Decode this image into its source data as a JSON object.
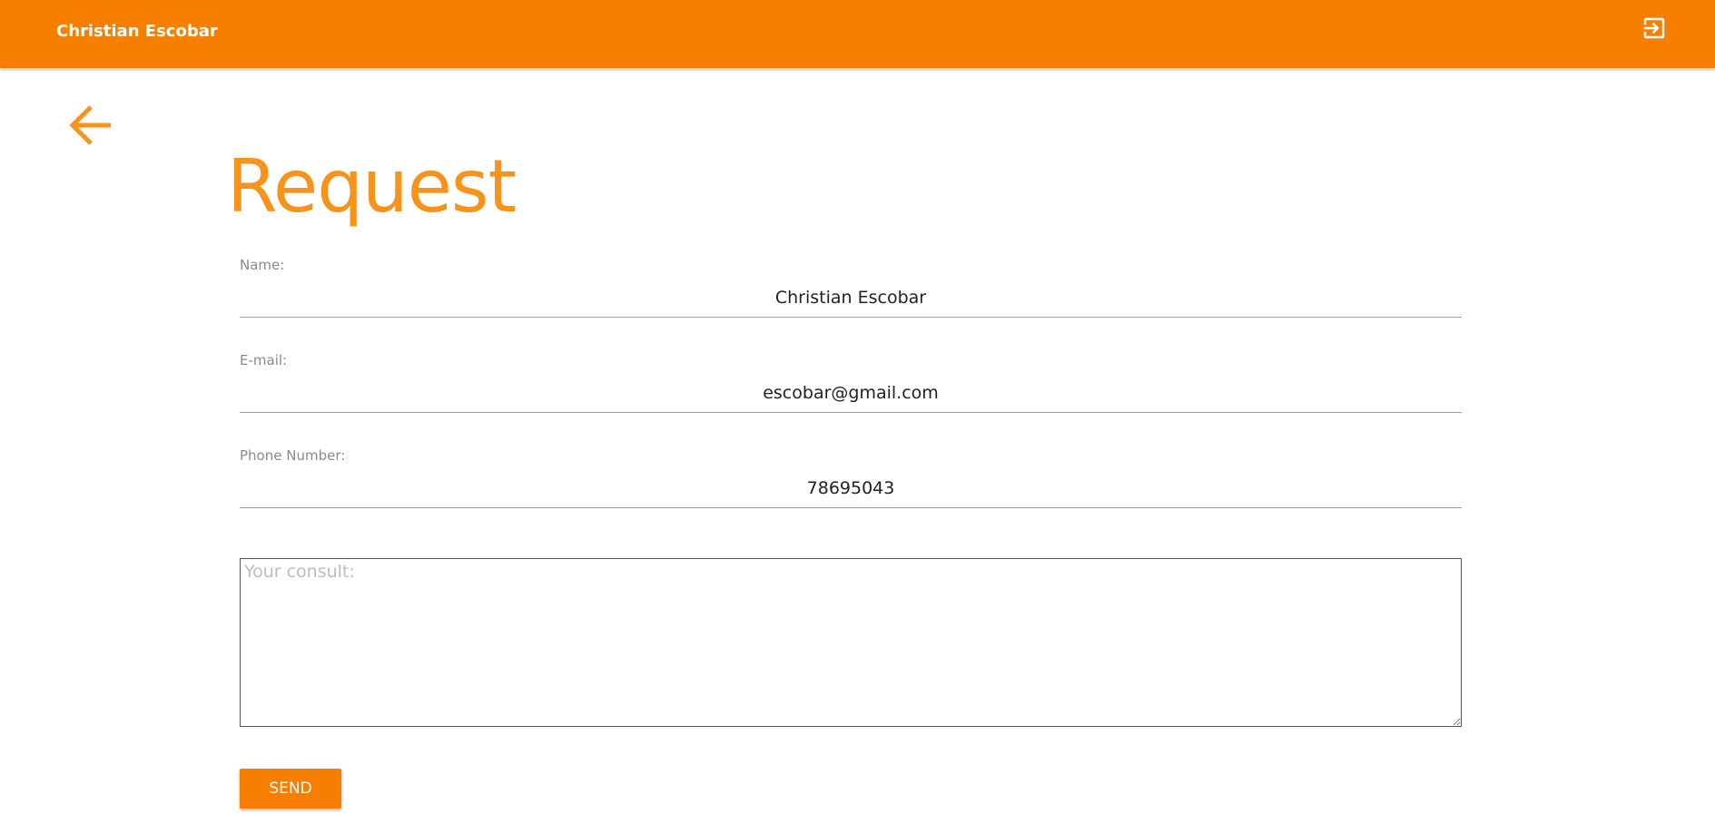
{
  "header": {
    "user_name": "Christian Escobar",
    "logout_icon": "logout-icon"
  },
  "nav": {
    "back_icon": "arrow-left-icon"
  },
  "page": {
    "title": "Request"
  },
  "form": {
    "name": {
      "label": "Name:",
      "value": "Christian Escobar"
    },
    "email": {
      "label": "E-mail:",
      "value": "escobar@gmail.com"
    },
    "phone": {
      "label": "Phone Number:",
      "value": "78695043"
    },
    "consult": {
      "placeholder": "Your consult:",
      "value": ""
    },
    "send_label": "SEND"
  },
  "colors": {
    "accent": "#f77f00",
    "title": "#f7931a"
  }
}
